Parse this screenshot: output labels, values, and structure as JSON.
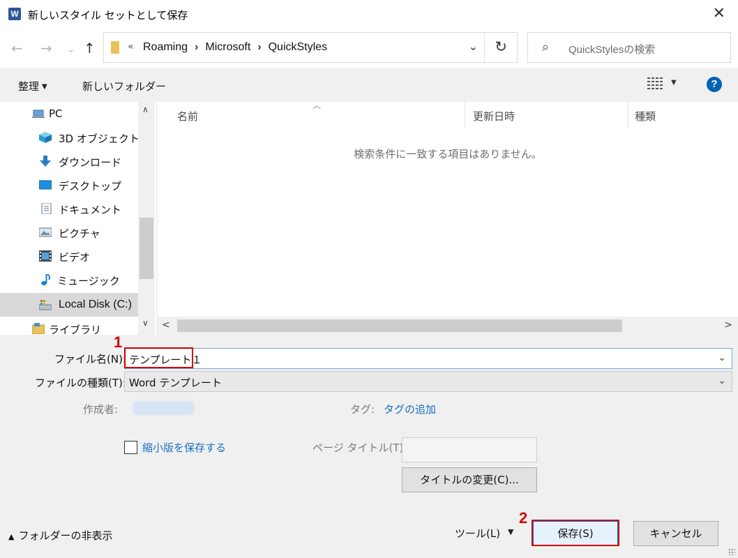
{
  "window": {
    "title": "新しいスタイル セットとして保存",
    "app_icon": "W"
  },
  "nav": {
    "back": "←",
    "forward": "→",
    "recent": "⌄",
    "up": "↑"
  },
  "address": {
    "overflow": "«",
    "crumbs": [
      "Roaming",
      "Microsoft",
      "QuickStyles"
    ],
    "separator": "›",
    "dropdown": "⌄",
    "refresh": "↻"
  },
  "search": {
    "placeholder": "QuickStylesの検索"
  },
  "toolbar": {
    "organize": "整理",
    "new_folder": "新しいフォルダー",
    "help": "?"
  },
  "sidebar": {
    "items": [
      {
        "label": "PC",
        "icon": "pc-icon",
        "selected": false
      },
      {
        "label": "3D オブジェクト",
        "icon": "3d-objects-icon",
        "selected": false
      },
      {
        "label": "ダウンロード",
        "icon": "download-icon",
        "selected": false
      },
      {
        "label": "デスクトップ",
        "icon": "desktop-icon",
        "selected": false
      },
      {
        "label": "ドキュメント",
        "icon": "documents-icon",
        "selected": false
      },
      {
        "label": "ピクチャ",
        "icon": "pictures-icon",
        "selected": false
      },
      {
        "label": "ビデオ",
        "icon": "video-icon",
        "selected": false
      },
      {
        "label": "ミュージック",
        "icon": "music-icon",
        "selected": false
      },
      {
        "label": "Local Disk (C:)",
        "icon": "disk-icon",
        "selected": true
      },
      {
        "label": "ライブラリ",
        "icon": "library-icon",
        "selected": false
      }
    ]
  },
  "filelist": {
    "columns": [
      "名前",
      "更新日時",
      "種類"
    ],
    "empty_message": "検索条件に一致する項目はありません。"
  },
  "form": {
    "filename_label": "ファイル名(N):",
    "filename_value": "テンプレート１",
    "filetype_label": "ファイルの種類(T):",
    "filetype_value": "Word テンプレート",
    "author_label": "作成者:",
    "tags_label": "タグ:",
    "tags_link": "タグの追加",
    "thumbnail_label": "縮小版を保存する",
    "page_title_label": "ページ タイトル(T):",
    "change_title_button": "タイトルの変更(C)..."
  },
  "footer": {
    "hide_folders": "フォルダーの非表示",
    "tools": "ツール(L)",
    "save": "保存(S)",
    "cancel": "キャンセル"
  },
  "annotations": {
    "step1": "1",
    "step2": "2"
  },
  "colors": {
    "accent": "#0078d7",
    "annotation_red": "#d10000",
    "link": "#1a6fc4"
  }
}
